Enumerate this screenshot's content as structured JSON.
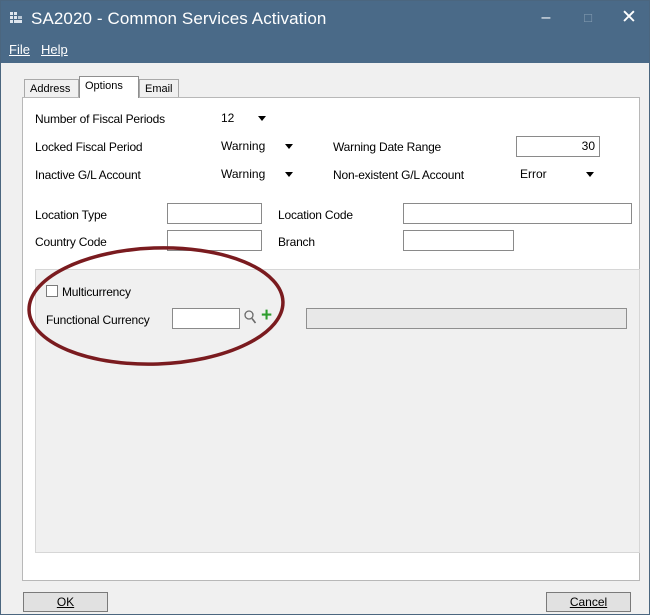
{
  "window": {
    "title": "SA2020 - Common Services Activation",
    "controls": {
      "minimize": "–",
      "maximize": "□",
      "close": "✕"
    }
  },
  "menu": {
    "file": "File",
    "help": "Help"
  },
  "tabs": [
    {
      "label": "Address",
      "active": false
    },
    {
      "label": "Options",
      "active": true
    },
    {
      "label": "Email",
      "active": false
    }
  ],
  "fiscal": {
    "periods_label": "Number of Fiscal Periods",
    "periods_value": "12",
    "locked_label": "Locked Fiscal Period",
    "locked_value": "Warning",
    "warning_range_label": "Warning Date Range",
    "warning_range_value": "30",
    "inactive_label": "Inactive G/L Account",
    "inactive_value": "Warning",
    "nonexistent_label": "Non-existent G/L Account",
    "nonexistent_value": "Error"
  },
  "location": {
    "type_label": "Location Type",
    "type_value": "",
    "code_label": "Location Code",
    "code_value": "",
    "country_label": "Country Code",
    "country_value": "",
    "branch_label": "Branch",
    "branch_value": ""
  },
  "currency": {
    "multicurrency_label": "Multicurrency",
    "multicurrency_checked": false,
    "functional_label": "Functional Currency",
    "functional_value": "",
    "description_value": ""
  },
  "buttons": {
    "ok": "OK",
    "cancel": "Cancel"
  },
  "colors": {
    "titlebar": "#4a6a88",
    "highlight_ellipse": "#7a1b1f",
    "add_icon": "#2e9d2e"
  },
  "icons": {
    "app": "app-icon",
    "finder": "search-icon",
    "new": "plus-icon"
  }
}
